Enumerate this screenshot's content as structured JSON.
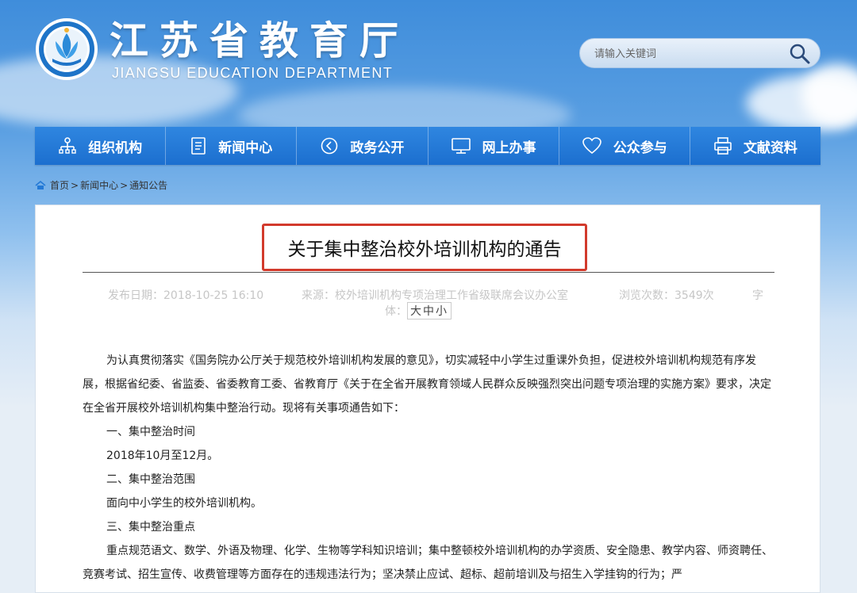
{
  "header": {
    "title": "江苏省教育厅",
    "subtitle": "JIANGSU EDUCATION DEPARTMENT"
  },
  "search": {
    "placeholder": "请输入关键词"
  },
  "nav": [
    {
      "label": "组织机构",
      "icon": "org-chart-icon"
    },
    {
      "label": "新闻中心",
      "icon": "document-icon"
    },
    {
      "label": "政务公开",
      "icon": "compass-icon"
    },
    {
      "label": "网上办事",
      "icon": "monitor-icon"
    },
    {
      "label": "公众参与",
      "icon": "heart-icon"
    },
    {
      "label": "文献资料",
      "icon": "printer-icon"
    }
  ],
  "breadcrumb": {
    "home": "首页",
    "news": "新闻中心",
    "current": "通知公告"
  },
  "article": {
    "title": "关于集中整治校外培训机构的通告",
    "date": "发布日期：2018-10-25 16:10",
    "source": "来源：校外培训机构专项治理工作省级联席会议办公室",
    "views": "浏览次数：3549次",
    "font_label_1": "字",
    "font_label_2": "体：",
    "size_large": "大",
    "size_medium": "中",
    "size_small": "小",
    "paragraphs": [
      "为认真贯彻落实《国务院办公厅关于规范校外培训机构发展的意见》，切实减轻中小学生过重课外负担，促进校外培训机构规范有序发展，根据省纪委、省监委、省委教育工委、省教育厅《关于在全省开展教育领域人民群众反映强烈突出问题专项治理的实施方案》要求，决定在全省开展校外培训机构集中整治行动。现将有关事项通告如下：",
      "一、集中整治时间",
      "2018年10月至12月。",
      "二、集中整治范围",
      "面向中小学生的校外培训机构。",
      "三、集中整治重点",
      "重点规范语文、数学、外语及物理、化学、生物等学科知识培训；集中整顿校外培训机构的办学资质、安全隐患、教学内容、师资聘任、竞赛考试、招生宣传、收费管理等方面存在的违规违法行为；坚决禁止应试、超标、超前培训及与招生入学挂钩的行为；严"
    ]
  },
  "colors": {
    "nav_blue": "#2379d6",
    "title_border": "#d23a2c"
  }
}
